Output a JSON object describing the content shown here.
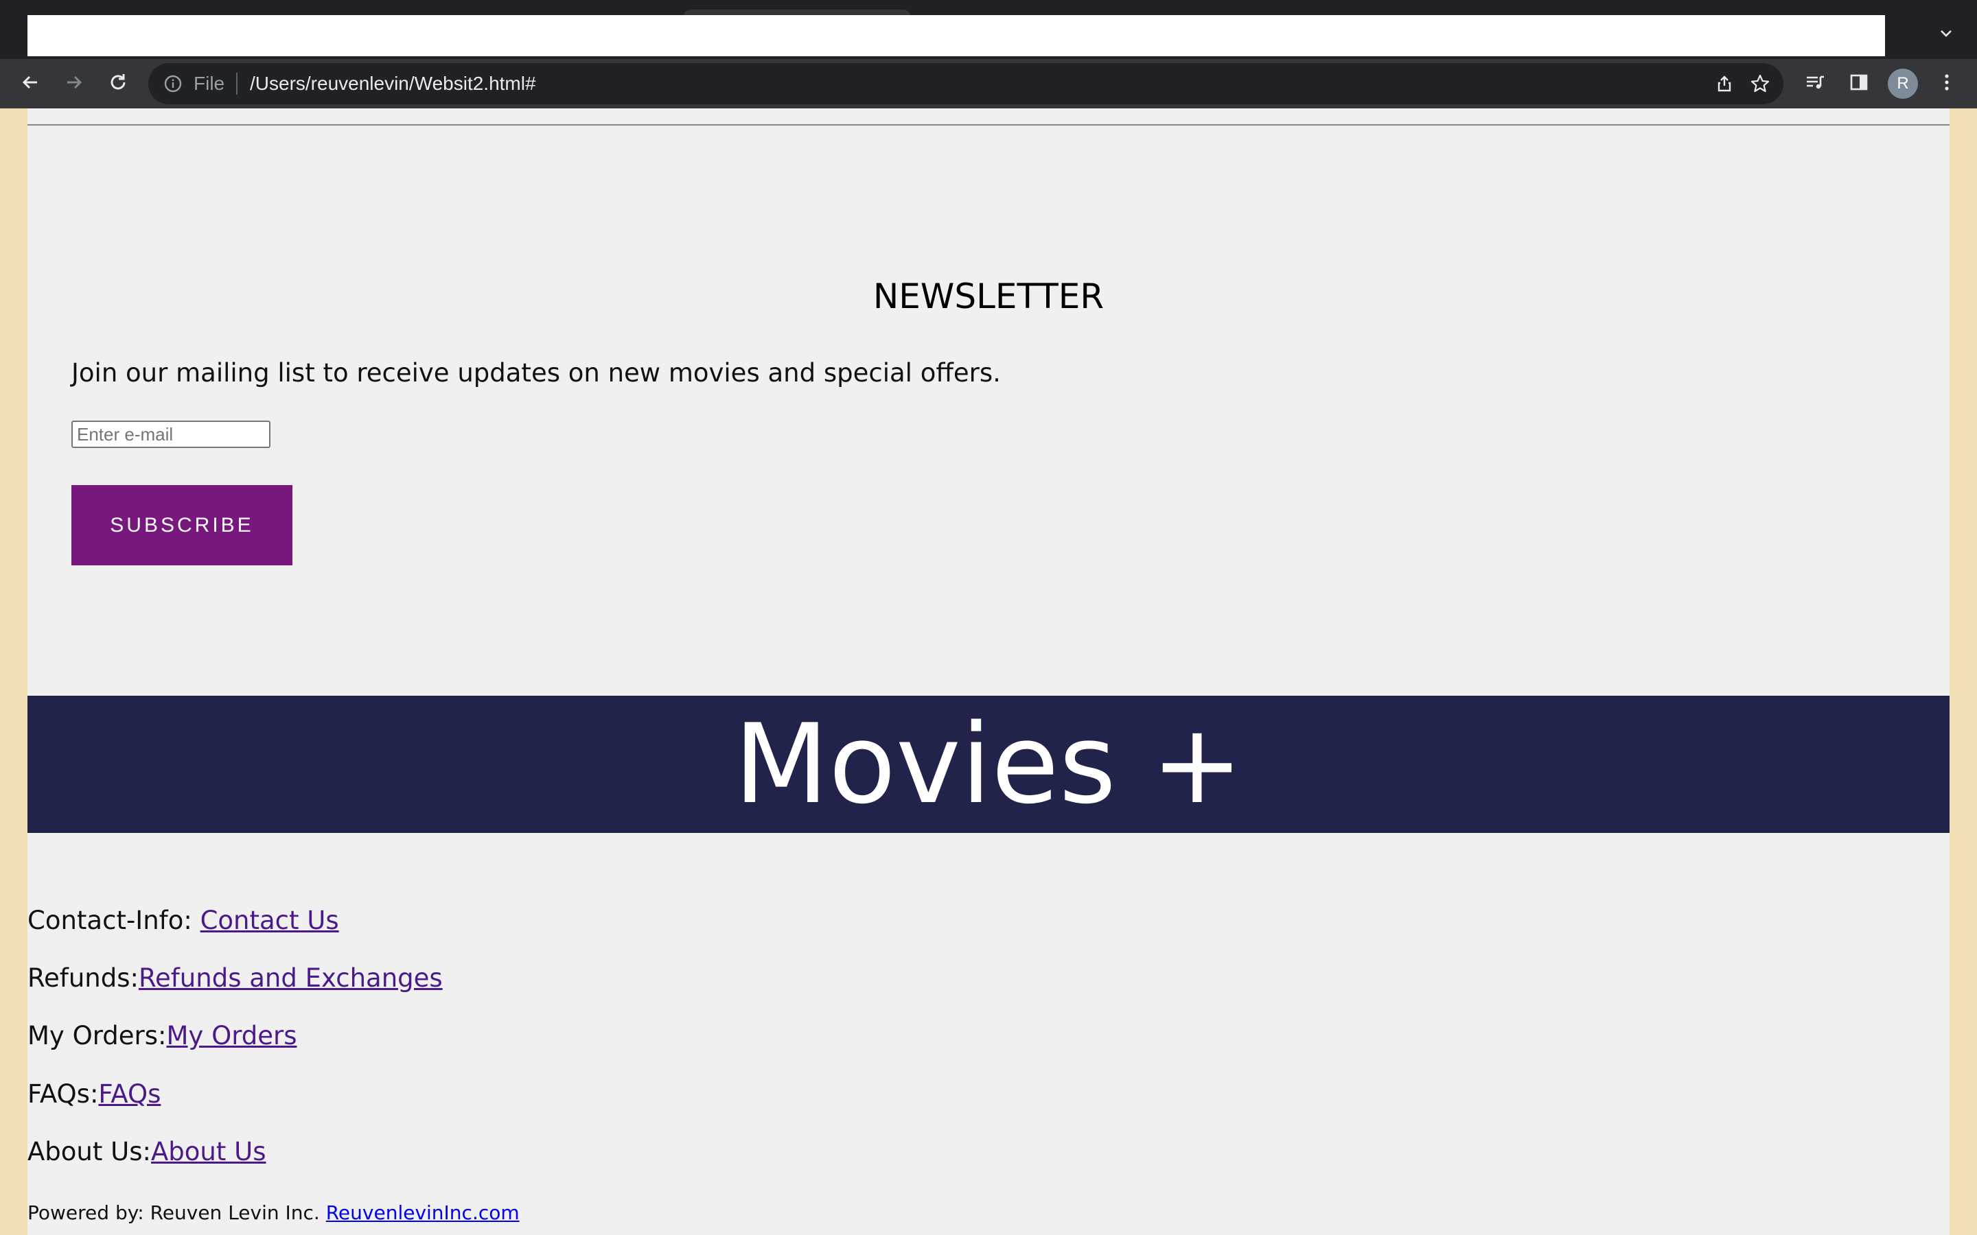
{
  "browser": {
    "omnibox": {
      "scheme_label": "File",
      "url": "/Users/reuvenlevin/Websit2.html#"
    },
    "profile_initial": "R"
  },
  "newsletter": {
    "title": "NEWSLETTER",
    "description": "Join our mailing list to receive updates on new movies and special offers.",
    "email_placeholder": "Enter e-mail",
    "email_value": "",
    "subscribe_label": "SUBSCRIBE"
  },
  "banner": {
    "title": "Movies +"
  },
  "footer": {
    "links": [
      {
        "label": "Contact-Info: ",
        "link": "Contact Us"
      },
      {
        "label": "Refunds:",
        "link": "Refunds and Exchanges"
      },
      {
        "label": "My Orders:",
        "link": "My Orders"
      },
      {
        "label": "FAQs:",
        "link": "FAQs"
      },
      {
        "label": "About Us:",
        "link": "About Us"
      }
    ],
    "powered_by": "Powered by: Reuven Levin Inc. ",
    "powered_link": "ReuvenlevinInc.com"
  },
  "colors": {
    "accent_purple": "#78187f",
    "banner_navy": "#22234a",
    "page_background": "#f0f0f0",
    "side_background": "#f1deb4",
    "link_purple": "#4b1a8a",
    "link_blue": "#0000ee"
  },
  "icons": [
    "back-icon",
    "forward-icon",
    "reload-icon",
    "info-icon",
    "share-icon",
    "bookmark-star-icon",
    "media-control-icon",
    "side-panel-icon",
    "menu-dots-icon",
    "chevron-down-icon"
  ]
}
